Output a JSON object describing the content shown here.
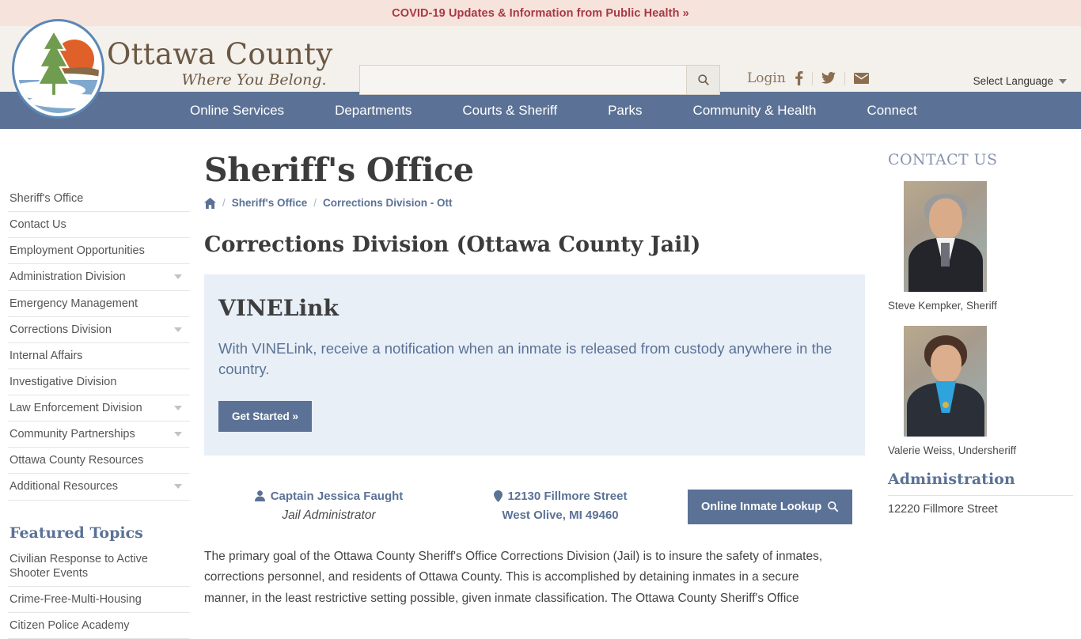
{
  "covid_banner": {
    "text": "COVID-19 Updates & Information from Public Health »"
  },
  "header": {
    "logo_title": "Ottawa County",
    "logo_tagline": "Where You Belong.",
    "search": {
      "value": "",
      "placeholder": "",
      "button_icon": "search-icon"
    },
    "login_label": "Login",
    "social": [
      {
        "name": "facebook-icon",
        "glyph": "f"
      },
      {
        "name": "twitter-icon",
        "glyph": "ᴠ"
      },
      {
        "name": "envelope-icon",
        "glyph": "✉"
      }
    ],
    "language_label": "Select Language"
  },
  "nav": {
    "items": [
      {
        "label": "Online Services"
      },
      {
        "label": "Departments"
      },
      {
        "label": "Courts & Sheriff"
      },
      {
        "label": "Parks"
      },
      {
        "label": "Community & Health"
      },
      {
        "label": "Connect"
      }
    ]
  },
  "main": {
    "page_title": "Sheriff's Office",
    "breadcrumb": {
      "home_icon": "home-icon",
      "items": [
        {
          "label": "Sheriff's Office"
        },
        {
          "label": "Corrections Division - Ott"
        }
      ]
    },
    "section_title": "Corrections Division (Ottawa County Jail)",
    "vinelink": {
      "heading": "VINELink",
      "description": "With VINELink, receive a notification when an inmate is released from custody anywhere in the country.",
      "button_label": "Get Started »"
    },
    "contact_row": {
      "person_name": "Captain Jessica Faught",
      "person_title": "Jail Administrator",
      "address_line1": "12130 Fillmore Street",
      "address_line2": "West Olive, MI 49460",
      "lookup_button": "Online Inmate Lookup"
    },
    "body_paragraph": "The primary goal of the Ottawa County Sheriff's Office Corrections Division (Jail) is to insure the safety of inmates, corrections personnel, and residents of Ottawa County. This is accomplished by detaining inmates in a secure manner, in the least restrictive setting possible, given inmate classification. The Ottawa County Sheriff's Office"
  },
  "sidebar": {
    "items": [
      {
        "label": "Sheriff's Office",
        "expandable": false
      },
      {
        "label": "Contact Us",
        "expandable": false
      },
      {
        "label": "Employment Opportunities",
        "expandable": false
      },
      {
        "label": "Administration Division",
        "expandable": true
      },
      {
        "label": "Emergency Management",
        "expandable": false
      },
      {
        "label": "Corrections Division",
        "expandable": true
      },
      {
        "label": "Internal Affairs",
        "expandable": false
      },
      {
        "label": "Investigative Division",
        "expandable": false
      },
      {
        "label": "Law Enforcement Division",
        "expandable": true
      },
      {
        "label": "Community Partnerships",
        "expandable": true
      },
      {
        "label": "Ottawa County Resources",
        "expandable": false
      },
      {
        "label": "Additional Resources",
        "expandable": true
      }
    ],
    "featured_title": "Featured Topics",
    "featured_items": [
      {
        "label": "Civilian Response to Active Shooter Events"
      },
      {
        "label": "Crime-Free-Multi-Housing"
      },
      {
        "label": "Citizen Police Academy"
      }
    ]
  },
  "right": {
    "contact_heading": "CONTACT US",
    "people": [
      {
        "caption": "Steve Kempker, Sheriff",
        "photo": "portrait-steve-kempker"
      },
      {
        "caption": "Valerie Weiss, Undersheriff",
        "photo": "portrait-valerie-weiss"
      }
    ],
    "admin_heading": "Administration",
    "admin_address": "12220 Fillmore Street"
  },
  "colors": {
    "nav_blue": "#5b7296",
    "banner_pink": "#f6e3dc",
    "banner_red": "#a93843",
    "panel_blue": "#e8eff7",
    "header_cream": "#f4f1ec"
  }
}
